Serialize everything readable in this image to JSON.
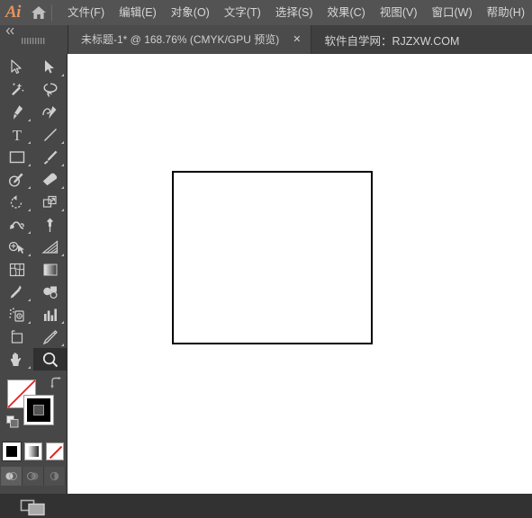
{
  "app": {
    "logo_text": "Ai",
    "home_icon": "home-icon"
  },
  "menubar": {
    "items": [
      {
        "label": "文件(F)",
        "name": "menu-file"
      },
      {
        "label": "编辑(E)",
        "name": "menu-edit"
      },
      {
        "label": "对象(O)",
        "name": "menu-object"
      },
      {
        "label": "文字(T)",
        "name": "menu-type"
      },
      {
        "label": "选择(S)",
        "name": "menu-select"
      },
      {
        "label": "效果(C)",
        "name": "menu-effect"
      },
      {
        "label": "视图(V)",
        "name": "menu-view"
      },
      {
        "label": "窗口(W)",
        "name": "menu-window"
      },
      {
        "label": "帮助(H)",
        "name": "menu-help"
      }
    ]
  },
  "tabbar": {
    "collapse_arrows": "«",
    "grip": "‖‖‖‖",
    "document_tab": {
      "title": "未标题-1* @ 168.76% (CMYK/GPU 预览)",
      "close_label": "✕",
      "document_name": "未标题-1*",
      "zoom_level": "168.76%",
      "color_mode": "CMYK",
      "preview_mode": "GPU 预览"
    },
    "watermark": "软件自学网：RJZXW.COM"
  },
  "toolbar": {
    "tools": [
      {
        "name": "selection-tool",
        "label": "选择工具",
        "icon": "arrow-outline-icon",
        "has_corner": false,
        "active": false
      },
      {
        "name": "direct-selection-tool",
        "label": "直接选择工具",
        "icon": "arrow-solid-icon",
        "has_corner": true,
        "active": false
      },
      {
        "name": "magic-wand-tool",
        "label": "魔棒工具",
        "icon": "magic-wand-icon",
        "has_corner": false,
        "active": false
      },
      {
        "name": "lasso-tool",
        "label": "套索工具",
        "icon": "lasso-icon",
        "has_corner": false,
        "active": false
      },
      {
        "name": "pen-tool",
        "label": "钢笔工具",
        "icon": "pen-icon",
        "has_corner": true,
        "active": false
      },
      {
        "name": "curvature-tool",
        "label": "曲率工具",
        "icon": "curvature-icon",
        "has_corner": false,
        "active": false
      },
      {
        "name": "type-tool",
        "label": "文字工具",
        "icon": "type-t-icon",
        "has_corner": true,
        "active": false
      },
      {
        "name": "line-segment-tool",
        "label": "直线段工具",
        "icon": "line-icon",
        "has_corner": true,
        "active": false
      },
      {
        "name": "rectangle-tool",
        "label": "矩形工具",
        "icon": "rectangle-icon",
        "has_corner": true,
        "active": false
      },
      {
        "name": "paintbrush-tool",
        "label": "画笔工具",
        "icon": "paintbrush-icon",
        "has_corner": true,
        "active": false
      },
      {
        "name": "shaper-tool",
        "label": "Shaper 工具",
        "icon": "shaper-pencil-icon",
        "has_corner": true,
        "active": false
      },
      {
        "name": "eraser-tool",
        "label": "橡皮擦工具",
        "icon": "eraser-icon",
        "has_corner": true,
        "active": false
      },
      {
        "name": "rotate-tool",
        "label": "旋转工具",
        "icon": "rotate-icon",
        "has_corner": true,
        "active": false
      },
      {
        "name": "scale-tool",
        "label": "缩放工具",
        "icon": "scale-icon",
        "has_corner": true,
        "active": false
      },
      {
        "name": "width-tool",
        "label": "宽度工具",
        "icon": "width-warp-icon",
        "has_corner": true,
        "active": false
      },
      {
        "name": "free-transform-tool",
        "label": "自由变换工具",
        "icon": "pushpin-icon",
        "has_corner": false,
        "active": false
      },
      {
        "name": "shape-builder-tool",
        "label": "形状生成器工具",
        "icon": "shape-builder-icon",
        "has_corner": true,
        "active": false
      },
      {
        "name": "perspective-grid-tool",
        "label": "透视网格工具",
        "icon": "perspective-grid-icon",
        "has_corner": true,
        "active": false
      },
      {
        "name": "mesh-tool",
        "label": "网格工具",
        "icon": "mesh-icon",
        "has_corner": false,
        "active": false
      },
      {
        "name": "gradient-tool",
        "label": "渐变工具",
        "icon": "gradient-icon",
        "has_corner": false,
        "active": false
      },
      {
        "name": "eyedropper-tool",
        "label": "吸管工具",
        "icon": "eyedropper-icon",
        "has_corner": true,
        "active": false
      },
      {
        "name": "blend-tool",
        "label": "混合工具",
        "icon": "blend-icon",
        "has_corner": false,
        "active": false
      },
      {
        "name": "symbol-sprayer-tool",
        "label": "符号喷枪工具",
        "icon": "symbol-sprayer-icon",
        "has_corner": true,
        "active": false
      },
      {
        "name": "column-graph-tool",
        "label": "柱形图工具",
        "icon": "bar-chart-icon",
        "has_corner": true,
        "active": false
      },
      {
        "name": "artboard-tool",
        "label": "画板工具",
        "icon": "artboard-icon",
        "has_corner": false,
        "active": false
      },
      {
        "name": "slice-tool",
        "label": "切片工具",
        "icon": "slice-knife-icon",
        "has_corner": true,
        "active": false
      },
      {
        "name": "hand-tool",
        "label": "抓手工具",
        "icon": "hand-icon",
        "has_corner": true,
        "active": false
      },
      {
        "name": "zoom-tool",
        "label": "缩放工具",
        "icon": "magnifier-icon",
        "has_corner": false,
        "active": true
      }
    ],
    "color_controls": {
      "fill": {
        "name": "fill-swatch",
        "value": "none",
        "color": "#ffffff"
      },
      "stroke": {
        "name": "stroke-swatch",
        "value": "black",
        "color": "#000000"
      },
      "swap_icon": "swap-arrow-icon",
      "default_icon": "default-colors-icon"
    },
    "mini_swatches": [
      {
        "name": "color-swatch-button",
        "icon": "solid-color-icon",
        "selected": true
      },
      {
        "name": "gradient-swatch-button",
        "icon": "gradient-icon",
        "selected": false
      },
      {
        "name": "none-swatch-button",
        "icon": "none-slash-icon",
        "selected": false
      }
    ],
    "draw_modes": [
      {
        "name": "draw-normal-mode",
        "icon": "draw-normal-icon",
        "active": true
      },
      {
        "name": "draw-behind-mode",
        "icon": "draw-behind-icon",
        "active": false
      },
      {
        "name": "draw-inside-mode",
        "icon": "draw-inside-icon",
        "active": false
      }
    ],
    "screen_mode": {
      "name": "screen-mode-button",
      "icon": "screen-mode-icon"
    }
  },
  "canvas": {
    "name": "artboard",
    "shape": {
      "name": "rectangle-shape",
      "fill": "#ffffff",
      "stroke": "#000000"
    }
  },
  "colors": {
    "chrome_bg": "#535353",
    "panel_bg": "#474747",
    "tabbar_bg": "#3f3f3f",
    "tab_active_bg": "#4b4b4b",
    "canvas_bg": "#ffffff",
    "accent": "#e8925c"
  }
}
